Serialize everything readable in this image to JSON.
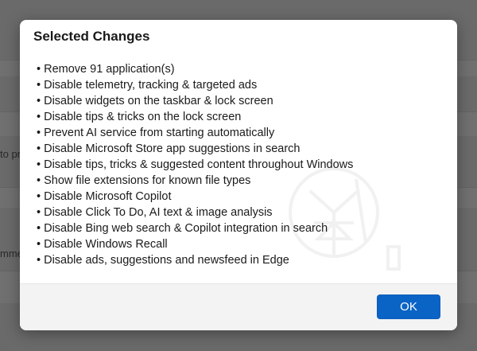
{
  "background": {
    "fragment_1": "to pr",
    "fragment_2": "mme"
  },
  "dialog": {
    "title": "Selected Changes",
    "items": [
      "• Remove 91 application(s)",
      "• Disable telemetry, tracking & targeted ads",
      "• Disable widgets on the taskbar & lock screen",
      "• Disable tips & tricks on the lock screen",
      "• Prevent AI service from starting automatically",
      "• Disable Microsoft Store app suggestions in search",
      "• Disable tips, tricks & suggested content throughout Windows",
      "• Show file extensions for known file types",
      "• Disable Microsoft Copilot",
      "• Disable Click To Do, AI text & image analysis",
      "• Disable Bing web search & Copilot integration in search",
      "• Disable Windows Recall",
      "• Disable ads, suggestions and newsfeed in Edge"
    ],
    "ok_label": "OK"
  },
  "colors": {
    "accent": "#0a64c6",
    "overlay": "#6a6a6a",
    "footer": "#f3f3f3"
  }
}
